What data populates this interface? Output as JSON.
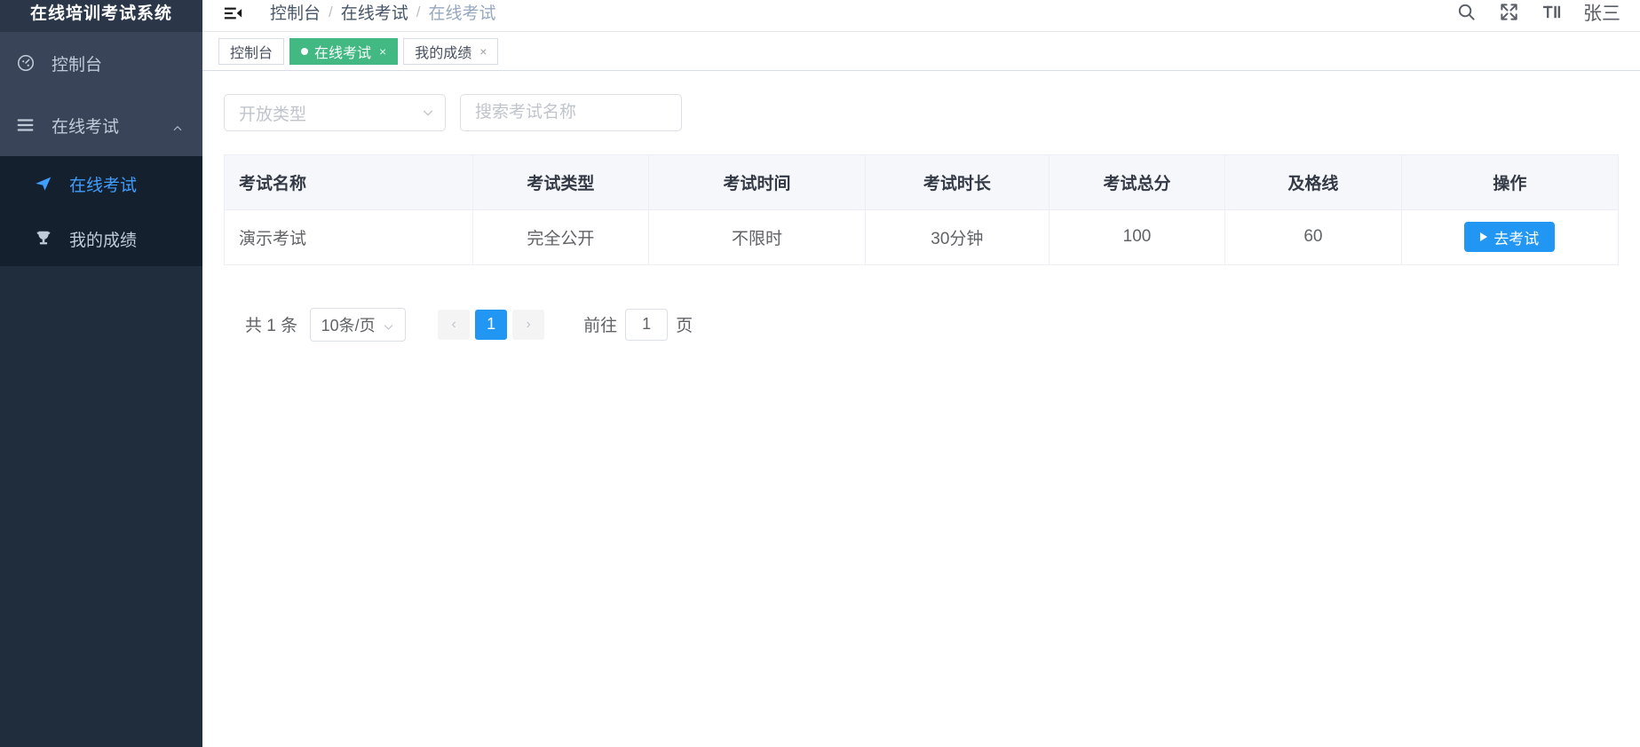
{
  "sidebar": {
    "logo": "在线培训考试系统",
    "items": [
      {
        "label": "控制台",
        "icon": "dashboard-icon"
      },
      {
        "label": "在线考试",
        "icon": "list-icon",
        "expanded": true
      }
    ],
    "subitems": [
      {
        "label": "在线考试",
        "icon": "paper-plane-icon",
        "active": true
      },
      {
        "label": "我的成绩",
        "icon": "trophy-icon",
        "active": false
      }
    ],
    "bg_color": "#1f2d3d",
    "active_color": "#409eff"
  },
  "header": {
    "fold_icon": "fold-menu-icon",
    "breadcrumb": [
      "控制台",
      "在线考试",
      "在线考试"
    ],
    "separator": "/",
    "icons": [
      "search-icon",
      "fullscreen-icon",
      "font-size-icon"
    ],
    "username": "张三"
  },
  "tabs": [
    {
      "label": "控制台",
      "active": false,
      "closable": false
    },
    {
      "label": "在线考试",
      "active": true,
      "closable": true,
      "close": "×"
    },
    {
      "label": "我的成绩",
      "active": false,
      "closable": true,
      "close": "×"
    }
  ],
  "tab_active_color": "#42b983",
  "filters": {
    "open_type_placeholder": "开放类型",
    "search_placeholder": "搜索考试名称",
    "search_value": ""
  },
  "table": {
    "columns": [
      "考试名称",
      "考试类型",
      "考试时间",
      "考试时长",
      "考试总分",
      "及格线",
      "操作"
    ],
    "rows": [
      {
        "name": "演示考试",
        "type": "完全公开",
        "time": "不限时",
        "duration": "30分钟",
        "total_score": "100",
        "pass_line": "60",
        "action_label": "去考试"
      }
    ],
    "action_button_color": "#2196f3"
  },
  "pagination": {
    "total_text": "共 1 条",
    "page_size": "10条/页",
    "prev": "‹",
    "next": "›",
    "current_page": "1",
    "jump_prefix": "前往",
    "jump_value": "1",
    "jump_suffix": "页"
  }
}
